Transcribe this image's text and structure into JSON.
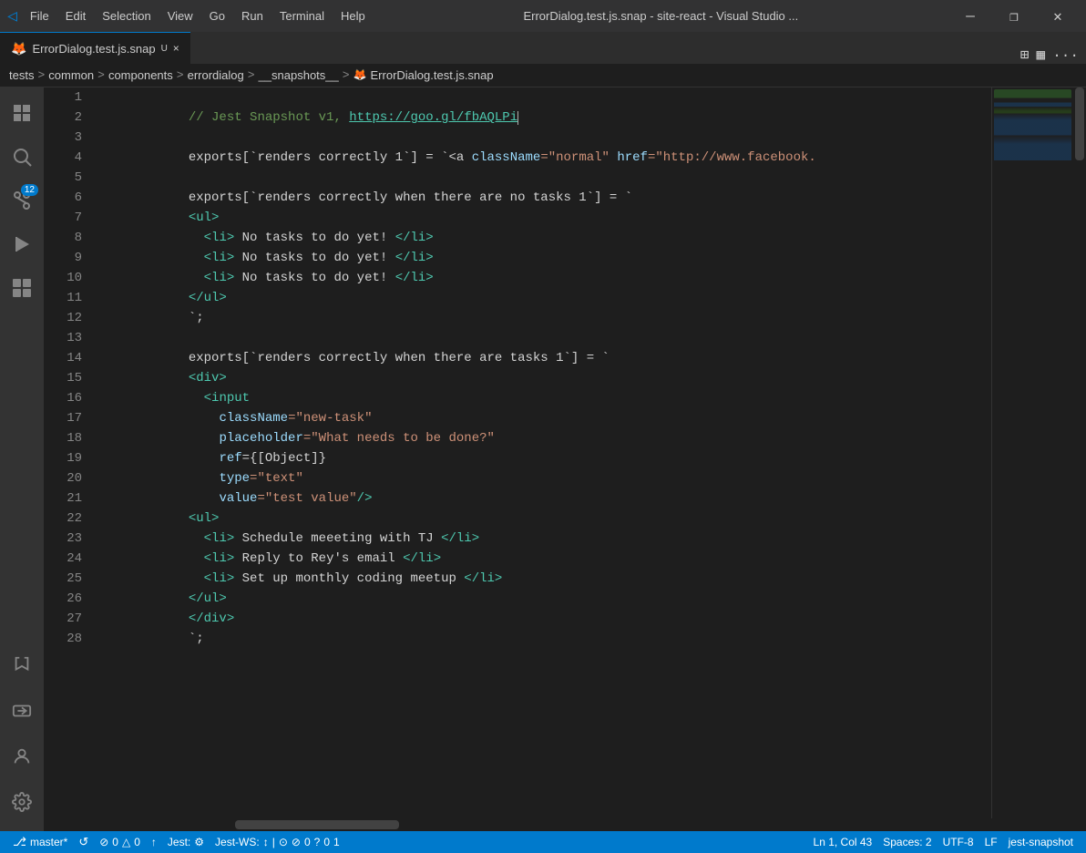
{
  "titleBar": {
    "logo": "◁",
    "menus": [
      "File",
      "Edit",
      "Selection",
      "View",
      "Go",
      "Run",
      "Terminal",
      "Help"
    ],
    "title": "ErrorDialog.test.js.snap - site-react - Visual Studio ...",
    "minimize": "—",
    "restore": "❐",
    "close": "✕"
  },
  "tab": {
    "icon": "🦊",
    "filename": "ErrorDialog.test.js.snap",
    "modified": "U",
    "close": "×"
  },
  "breadcrumb": {
    "items": [
      "tests",
      "common",
      "components",
      "errordialog",
      "__snapshots__",
      "ErrorDialog.test.js.snap"
    ],
    "separator": ">"
  },
  "activityBar": {
    "items": [
      {
        "icon": "⎘",
        "name": "source-control",
        "badge": null
      },
      {
        "icon": "🔍",
        "name": "search",
        "badge": null
      },
      {
        "icon": "⎋",
        "name": "git",
        "badge": "12"
      },
      {
        "icon": "▷",
        "name": "run-debug",
        "badge": null
      },
      {
        "icon": "⊞",
        "name": "extensions",
        "badge": null
      }
    ],
    "bottom": [
      {
        "icon": "⚗",
        "name": "test"
      },
      {
        "icon": "☰",
        "name": "remote"
      },
      {
        "icon": "👤",
        "name": "account"
      },
      {
        "icon": "⚙",
        "name": "settings"
      }
    ]
  },
  "editor": {
    "lines": [
      {
        "num": 1,
        "tokens": [
          {
            "text": "// Jest Snapshot v1, ",
            "class": "c-comment"
          },
          {
            "text": "https://goo.gl/fbAQLPi",
            "class": "c-link"
          },
          {
            "text": "",
            "cursor": true
          }
        ]
      },
      {
        "num": 2,
        "tokens": []
      },
      {
        "num": 3,
        "tokens": [
          {
            "text": "exports[`renders correctly 1`] = `<a ",
            "class": "c-export"
          },
          {
            "text": "className",
            "class": "c-attr"
          },
          {
            "text": "=\"normal\" ",
            "class": "c-string"
          },
          {
            "text": "href",
            "class": "c-attr"
          },
          {
            "text": "=\"http://www.facebook.",
            "class": "c-string"
          }
        ]
      },
      {
        "num": 4,
        "tokens": []
      },
      {
        "num": 5,
        "tokens": [
          {
            "text": "exports[`renders correctly when there are no tasks 1`] = `",
            "class": "c-export"
          }
        ]
      },
      {
        "num": 6,
        "tokens": [
          {
            "text": "<ul>",
            "class": "c-tag"
          }
        ]
      },
      {
        "num": 7,
        "tokens": [
          {
            "text": "  <li>",
            "class": "c-tag"
          },
          {
            "text": " No tasks to do yet! ",
            "class": "c-template"
          },
          {
            "text": "</li>",
            "class": "c-tag"
          }
        ]
      },
      {
        "num": 8,
        "tokens": [
          {
            "text": "  <li>",
            "class": "c-tag"
          },
          {
            "text": " No tasks to do yet! ",
            "class": "c-template"
          },
          {
            "text": "</li>",
            "class": "c-tag"
          }
        ]
      },
      {
        "num": 9,
        "tokens": [
          {
            "text": "  <li>",
            "class": "c-tag"
          },
          {
            "text": " No tasks to do yet! ",
            "class": "c-template"
          },
          {
            "text": "</li>",
            "class": "c-tag"
          }
        ]
      },
      {
        "num": 10,
        "tokens": [
          {
            "text": "</ul>",
            "class": "c-tag"
          }
        ]
      },
      {
        "num": 11,
        "tokens": [
          {
            "text": "`;",
            "class": "c-template"
          }
        ]
      },
      {
        "num": 12,
        "tokens": []
      },
      {
        "num": 13,
        "tokens": [
          {
            "text": "exports[`renders correctly when there are tasks 1`] = `",
            "class": "c-export"
          }
        ]
      },
      {
        "num": 14,
        "tokens": [
          {
            "text": "<div>",
            "class": "c-tag"
          }
        ]
      },
      {
        "num": 15,
        "tokens": [
          {
            "text": "  <input",
            "class": "c-tag"
          }
        ],
        "highlight": false
      },
      {
        "num": 16,
        "tokens": [
          {
            "text": "    className",
            "class": "c-attr"
          },
          {
            "text": "=\"new-task\"",
            "class": "c-string"
          }
        ]
      },
      {
        "num": 17,
        "tokens": [
          {
            "text": "    placeholder",
            "class": "c-attr"
          },
          {
            "text": "=\"What needs to be done?\"",
            "class": "c-string"
          }
        ]
      },
      {
        "num": 18,
        "tokens": [
          {
            "text": "    ref",
            "class": "c-attr"
          },
          {
            "text": "={[Object]}",
            "class": "c-value"
          }
        ]
      },
      {
        "num": 19,
        "tokens": [
          {
            "text": "    type",
            "class": "c-attr"
          },
          {
            "text": "=\"text\"",
            "class": "c-string"
          }
        ]
      },
      {
        "num": 20,
        "tokens": [
          {
            "text": "    value",
            "class": "c-attr"
          },
          {
            "text": "=\"test value\"",
            "class": "c-string"
          },
          {
            "text": "/>",
            "class": "c-tag"
          }
        ]
      },
      {
        "num": 21,
        "tokens": [
          {
            "text": "<ul>",
            "class": "c-tag"
          }
        ]
      },
      {
        "num": 22,
        "tokens": [
          {
            "text": "  <li>",
            "class": "c-tag"
          },
          {
            "text": " Schedule meeeting with TJ ",
            "class": "c-template"
          },
          {
            "text": "</li>",
            "class": "c-tag"
          }
        ]
      },
      {
        "num": 23,
        "tokens": [
          {
            "text": "  <li>",
            "class": "c-tag"
          },
          {
            "text": " Reply to Rey's email ",
            "class": "c-template"
          },
          {
            "text": "</li>",
            "class": "c-tag"
          }
        ]
      },
      {
        "num": 24,
        "tokens": [
          {
            "text": "  <li>",
            "class": "c-tag"
          },
          {
            "text": " Set up monthly coding meetup ",
            "class": "c-template"
          },
          {
            "text": "</li>",
            "class": "c-tag"
          }
        ]
      },
      {
        "num": 25,
        "tokens": [
          {
            "text": "</ul>",
            "class": "c-tag"
          }
        ]
      },
      {
        "num": 26,
        "tokens": [
          {
            "text": "</div>",
            "class": "c-tag"
          }
        ]
      },
      {
        "num": 27,
        "tokens": [
          {
            "text": "`;",
            "class": "c-template"
          }
        ]
      },
      {
        "num": 28,
        "tokens": []
      }
    ]
  },
  "statusBar": {
    "left": [
      {
        "icon": "⎇",
        "label": "master*"
      },
      {
        "icon": "↺",
        "label": ""
      },
      {
        "icon": "⊘",
        "label": "0"
      },
      {
        "icon": "△",
        "label": "0"
      },
      {
        "icon": "",
        "label": ""
      },
      {
        "icon": "↑",
        "label": ""
      }
    ],
    "right": [
      {
        "label": "Ln 1, Col 43"
      },
      {
        "label": "Spaces: 2"
      },
      {
        "label": "UTF-8"
      },
      {
        "label": "LF"
      },
      {
        "label": "jest-snapshot"
      }
    ],
    "jest": "Jest:",
    "jestWS": "Jest-WS:",
    "jestStatus": "⊘ | ⊙ ⊘ 0 ? 0 1"
  }
}
